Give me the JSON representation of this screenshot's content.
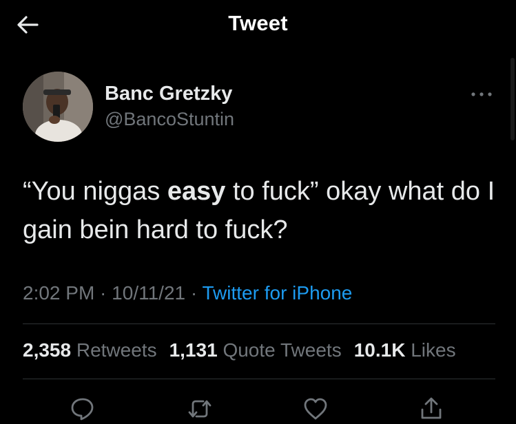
{
  "header": {
    "title": "Tweet",
    "back_icon": "arrow-left-icon"
  },
  "author": {
    "display_name": "Banc Gretzky",
    "handle": "@BancoStuntin",
    "avatar_icon": "avatar"
  },
  "tweet": {
    "text_before": "“You niggas ",
    "text_bold": "easy",
    "text_after": " to fuck” okay what do I gain bein hard to fuck?"
  },
  "meta": {
    "time": "2:02 PM",
    "separator1": " · ",
    "date": "10/11/21",
    "separator2": " · ",
    "source": "Twitter for iPhone"
  },
  "stats": {
    "retweets_count": "2,358",
    "retweets_label": "Retweets",
    "quotes_count": "1,131",
    "quotes_label": "Quote Tweets",
    "likes_count": "10.1K",
    "likes_label": "Likes"
  },
  "actions": {
    "reply_icon": "reply-icon",
    "retweet_icon": "retweet-icon",
    "like_icon": "heart-icon",
    "share_icon": "share-icon"
  },
  "colors": {
    "background": "#000000",
    "text": "#e7e9ea",
    "secondary": "#71767b",
    "accent": "#1d9bf0",
    "divider": "#2f3336"
  }
}
